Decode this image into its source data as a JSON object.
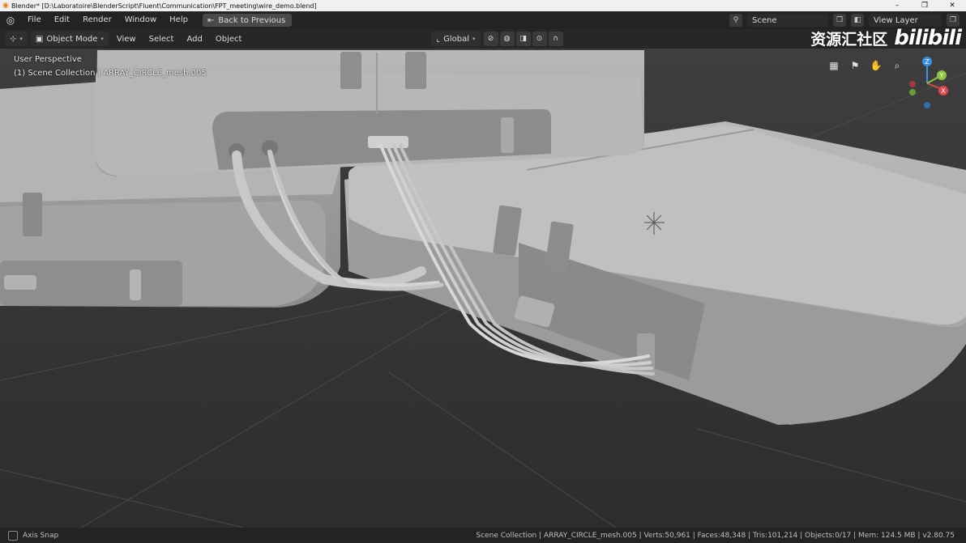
{
  "window": {
    "title": "Blender* [D:\\Laboratoire\\BlenderScript\\Fluent\\Communication\\FPT_meeting\\wire_demo.blend]",
    "controls": [
      "–",
      "❐",
      "✕"
    ]
  },
  "topbar": {
    "menus": [
      "File",
      "Edit",
      "Render",
      "Window",
      "Help"
    ],
    "back_button": "Back to Previous",
    "scene": "Scene",
    "view_layer": "View Layer"
  },
  "header3d": {
    "mode": "Object Mode",
    "menus": [
      "View",
      "Select",
      "Add",
      "Object"
    ],
    "orientation": "Global"
  },
  "viewport": {
    "perspective": "User Perspective",
    "collection_info": "(1) Scene Collection | ARRAY_CIRCLE_mesh.005",
    "gizmo_axes": {
      "x": "X",
      "y": "Y",
      "z": "Z"
    }
  },
  "watermark": {
    "text": "资源汇社区",
    "brand": "bilibili"
  },
  "statusbar": {
    "left_label": "Axis Snap",
    "stats": "Scene Collection | ARRAY_CIRCLE_mesh.005 | Verts:50,961 | Faces:48,348 | Tris:101,214 | Objects:0/17 | Mem: 124.5 MB | v2.80.75"
  },
  "colors": {
    "titlebar": "#f0f0f0",
    "ui_bg": "#232323",
    "viewport_bg": "#3b3b3b",
    "axis_x": "#e0474c",
    "axis_y": "#8cc63f",
    "axis_z": "#3d8fe0"
  }
}
